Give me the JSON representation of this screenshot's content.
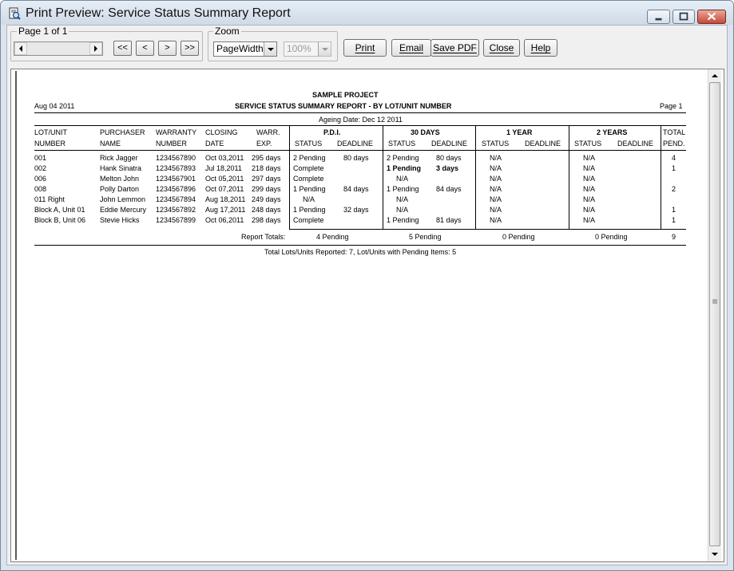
{
  "window": {
    "title": "Print Preview: Service Status Summary Report"
  },
  "toolbar": {
    "page_group_label": "Page 1 of 1",
    "first_label": "<<",
    "prev_label": "<",
    "next_label": ">",
    "last_label": ">>",
    "zoom_group_label": "Zoom",
    "zoom_mode": "PageWidth",
    "zoom_percent": "100%",
    "print_label": "Print",
    "email_label": "Email",
    "save_pdf_label": "Save PDF",
    "close_label": "Close",
    "help_label": "Help"
  },
  "report": {
    "date": "Aug 04 2011",
    "project": "SAMPLE PROJECT",
    "title": "SERVICE STATUS SUMMARY REPORT - BY LOT/UNIT NUMBER",
    "page": "Page 1",
    "ageing_date": "Ageing Date: Dec 12 2011",
    "col_headers": {
      "lot_1": "LOT/UNIT",
      "lot_2": "NUMBER",
      "purchaser_1": "PURCHASER",
      "purchaser_2": "NAME",
      "warranty_1": "WARRANTY",
      "warranty_2": "NUMBER",
      "closing_1": "CLOSING",
      "closing_2": "DATE",
      "warr_1": "WARR.",
      "warr_2": "EXP.",
      "pdi": "P.D.I.",
      "d30": "30 DAYS",
      "y1": "1 YEAR",
      "y2": "2 YEARS",
      "status": "STATUS",
      "deadline": "DEADLINE",
      "total_1": "TOTAL",
      "total_2": "PEND."
    },
    "rows": [
      {
        "lot": "001",
        "name": "Rick Jagger",
        "warranty": "1234567890",
        "closing": "Oct 03,2011",
        "exp": "295 days",
        "pdi_status": "2 Pending",
        "pdi_deadline": "80 days",
        "d30_status": "2 Pending",
        "d30_deadline": "80 days",
        "y1_status": "N/A",
        "y2_status": "N/A",
        "total": "4"
      },
      {
        "lot": "002",
        "name": "Hank Sinatra",
        "warranty": "1234567893",
        "closing": "Jul 18,2011",
        "exp": "218 days",
        "pdi_status": "Complete",
        "pdi_deadline": "",
        "d30_status": "1 Pending",
        "d30_deadline": "3 days",
        "y1_status": "N/A",
        "y2_status": "N/A",
        "total": "1"
      },
      {
        "lot": "006",
        "name": "Melton John",
        "warranty": "1234567901",
        "closing": "Oct 05,2011",
        "exp": "297 days",
        "pdi_status": "Complete",
        "pdi_deadline": "",
        "d30_status": "N/A",
        "d30_deadline": "",
        "y1_status": "N/A",
        "y2_status": "N/A",
        "total": ""
      },
      {
        "lot": "008",
        "name": "Polly Darton",
        "warranty": "1234567896",
        "closing": "Oct 07,2011",
        "exp": "299 days",
        "pdi_status": "1 Pending",
        "pdi_deadline": "84 days",
        "d30_status": "1 Pending",
        "d30_deadline": "84 days",
        "y1_status": "N/A",
        "y2_status": "N/A",
        "total": "2"
      },
      {
        "lot": "011 Right",
        "name": "John Lemmon",
        "warranty": "1234567894",
        "closing": "Aug 18,2011",
        "exp": "249 days",
        "pdi_status": "N/A",
        "pdi_deadline": "",
        "d30_status": "N/A",
        "d30_deadline": "",
        "y1_status": "N/A",
        "y2_status": "N/A",
        "total": ""
      },
      {
        "lot": "Block A, Unit 01",
        "name": "Eddie Mercury",
        "warranty": "1234567892",
        "closing": "Aug 17,2011",
        "exp": "248 days",
        "pdi_status": "1 Pending",
        "pdi_deadline": "32 days",
        "d30_status": "N/A",
        "d30_deadline": "",
        "y1_status": "N/A",
        "y2_status": "N/A",
        "total": "1"
      },
      {
        "lot": "Block B, Unit 06",
        "name": "Stevie Hicks",
        "warranty": "1234567899",
        "closing": "Oct 06,2011",
        "exp": "298 days",
        "pdi_status": "Complete",
        "pdi_deadline": "",
        "d30_status": "1 Pending",
        "d30_deadline": "81 days",
        "y1_status": "N/A",
        "y2_status": "N/A",
        "total": "1"
      }
    ],
    "totals_label": "Report Totals:",
    "totals": {
      "pdi": "4 Pending",
      "d30": "5 Pending",
      "y1": "0 Pending",
      "y2": "0 Pending",
      "total": "9"
    },
    "footer": "Total Lots/Units Reported: 7,  Lot/Units with Pending Items: 5"
  }
}
